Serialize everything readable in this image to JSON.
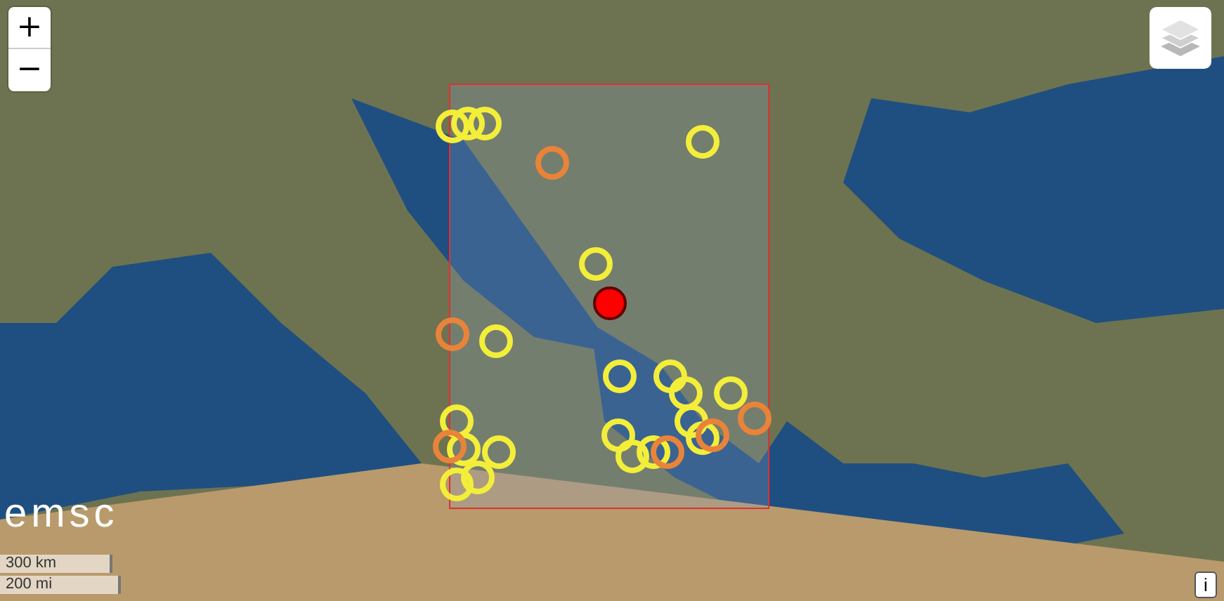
{
  "zoom": {
    "in": "+",
    "out": "−"
  },
  "logo": "emsc",
  "scale": {
    "metric": "300 km",
    "imperial": "200 mi"
  },
  "info_button": "i",
  "markers": [
    {
      "kind": "ring",
      "color": "#f3ee3a"
    },
    {
      "kind": "ring",
      "color": "#f3ee3a"
    },
    {
      "kind": "ring",
      "color": "#f3ee3a"
    },
    {
      "kind": "ring",
      "color": "#f3ee3a"
    },
    {
      "kind": "ring",
      "color": "#f3ee3a"
    },
    {
      "kind": "ring",
      "color": "#f3ee3a"
    },
    {
      "kind": "ring",
      "color": "#f3ee3a"
    },
    {
      "kind": "ring",
      "color": "#f3ee3a"
    },
    {
      "kind": "ring",
      "color": "#f3ee3a"
    },
    {
      "kind": "ring",
      "color": "#f3ee3a"
    },
    {
      "kind": "ring",
      "color": "#f3ee3a"
    },
    {
      "kind": "ring",
      "color": "#f3ee3a"
    },
    {
      "kind": "ring",
      "color": "#f3ee3a"
    },
    {
      "kind": "ring",
      "color": "#f3ee3a"
    },
    {
      "kind": "ring",
      "color": "#f3ee3a"
    },
    {
      "kind": "ring",
      "color": "#f3ee3a"
    },
    {
      "kind": "ring",
      "color": "#f3ee3a"
    },
    {
      "kind": "ring",
      "color": "#f3ee3a"
    },
    {
      "kind": "ring",
      "color": "#f3ee3a"
    },
    {
      "kind": "ring",
      "color": "#f3ee3a"
    },
    {
      "kind": "ring",
      "color": "#e8843a"
    },
    {
      "kind": "ring",
      "color": "#e8843a"
    },
    {
      "kind": "ring",
      "color": "#e8843a"
    },
    {
      "kind": "ring",
      "color": "#e8843a"
    },
    {
      "kind": "ring",
      "color": "#e8843a"
    },
    {
      "kind": "ring",
      "color": "#e8843a"
    },
    {
      "kind": "main",
      "color": "#ff0000"
    }
  ]
}
